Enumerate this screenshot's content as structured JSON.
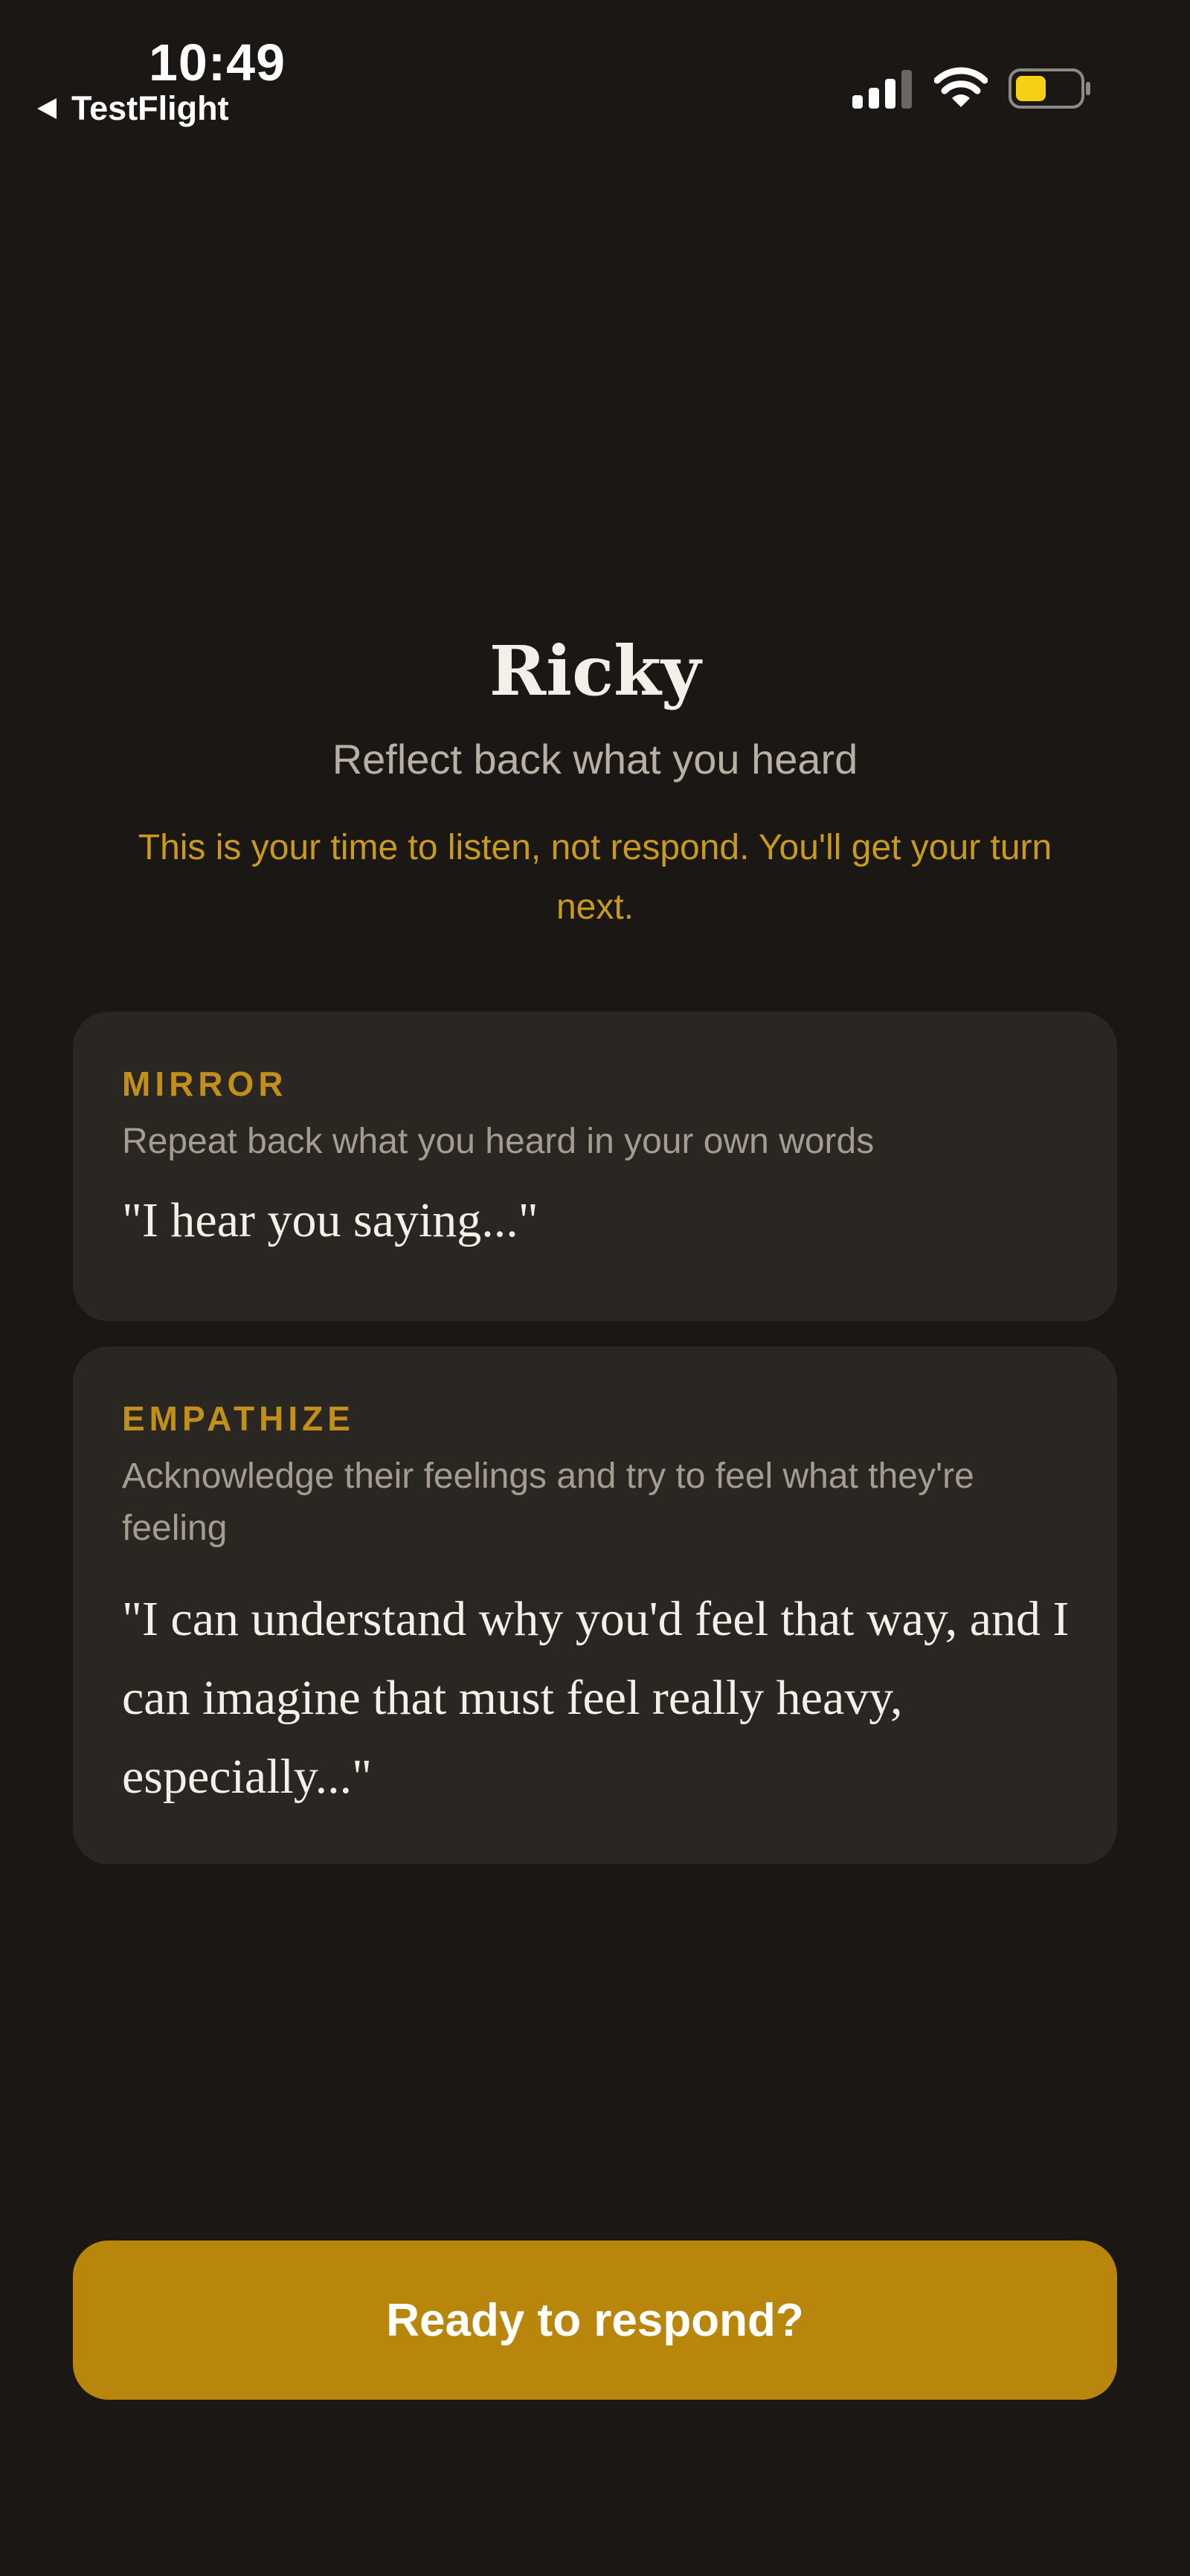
{
  "status_bar": {
    "time": "10:49",
    "back_label": "TestFlight",
    "icons": [
      "back-triangle-icon",
      "cellular-signal-icon",
      "wifi-icon",
      "battery-icon"
    ],
    "battery_color": "#f5d014"
  },
  "header": {
    "title": "Ricky",
    "subtitle": "Reflect back what you heard",
    "note": "This is your time to listen, not respond. You'll get your turn next."
  },
  "cards": [
    {
      "label": "MIRROR",
      "description": "Repeat back what you heard in your own words",
      "quote": "\"I hear you saying...\""
    },
    {
      "label": "EMPATHIZE",
      "description": "Acknowledge their feelings and try to feel what they're feeling",
      "quote": "\"I can understand why you'd feel that way, and I can imagine that must feel really heavy, especially...\""
    }
  ],
  "button": {
    "label": "Ready to respond?"
  },
  "colors": {
    "background": "#1a1715",
    "card": "#2a2622",
    "accent": "#b8860b",
    "accent_text": "#c89a1e"
  }
}
